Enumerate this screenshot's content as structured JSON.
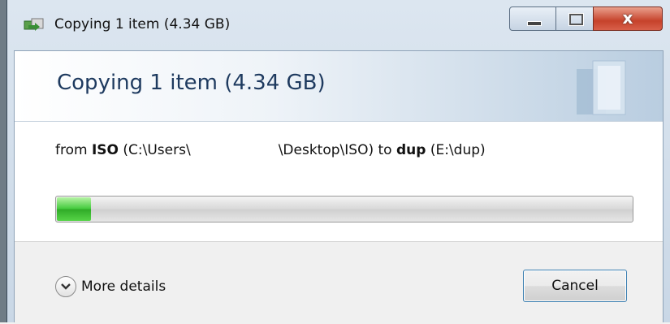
{
  "window": {
    "title": "Copying 1 item (4.34 GB)",
    "controls": {
      "minimize_icon": "minimize-icon",
      "maximize_icon": "maximize-icon",
      "close_glyph": "x"
    }
  },
  "header": {
    "title": "Copying 1 item (4.34 GB)"
  },
  "transfer": {
    "from_prefix": "from ",
    "source_name": "ISO",
    "source_path": " (C:\\Users\\",
    "source_path_rest": "\\Desktop\\ISO)",
    "to_word": " to ",
    "dest_name": "dup",
    "dest_path": " (E:\\dup)"
  },
  "progress": {
    "fraction": 0.06,
    "color": "#3ec337"
  },
  "footer": {
    "more_details_label": "More details",
    "cancel_label": "Cancel"
  }
}
